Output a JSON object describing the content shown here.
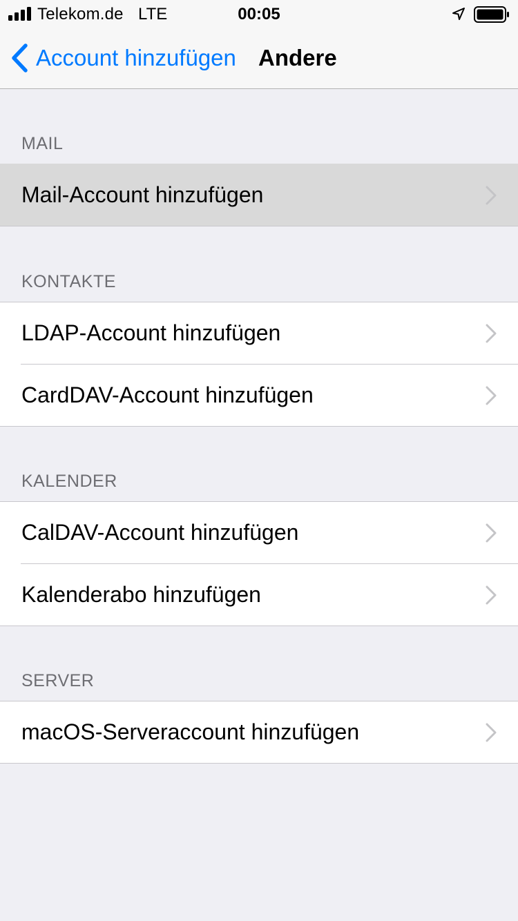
{
  "status_bar": {
    "carrier": "Telekom.de",
    "network": "LTE",
    "time": "00:05",
    "icons": [
      "signal-bars-icon",
      "location-arrow-icon",
      "battery-icon"
    ]
  },
  "nav": {
    "back_label": "Account hinzufügen",
    "title": "Andere",
    "accent_color": "#007aff"
  },
  "sections": [
    {
      "header": "MAIL",
      "rows": [
        "Mail-Account hinzufügen"
      ]
    },
    {
      "header": "KONTAKTE",
      "rows": [
        "LDAP-Account hinzufügen",
        "CardDAV-Account hinzufügen"
      ]
    },
    {
      "header": "KALENDER",
      "rows": [
        "CalDAV-Account hinzufügen",
        "Kalenderabo hinzufügen"
      ]
    },
    {
      "header": "SERVER",
      "rows": [
        "macOS-Serveraccount hinzufügen"
      ]
    }
  ]
}
